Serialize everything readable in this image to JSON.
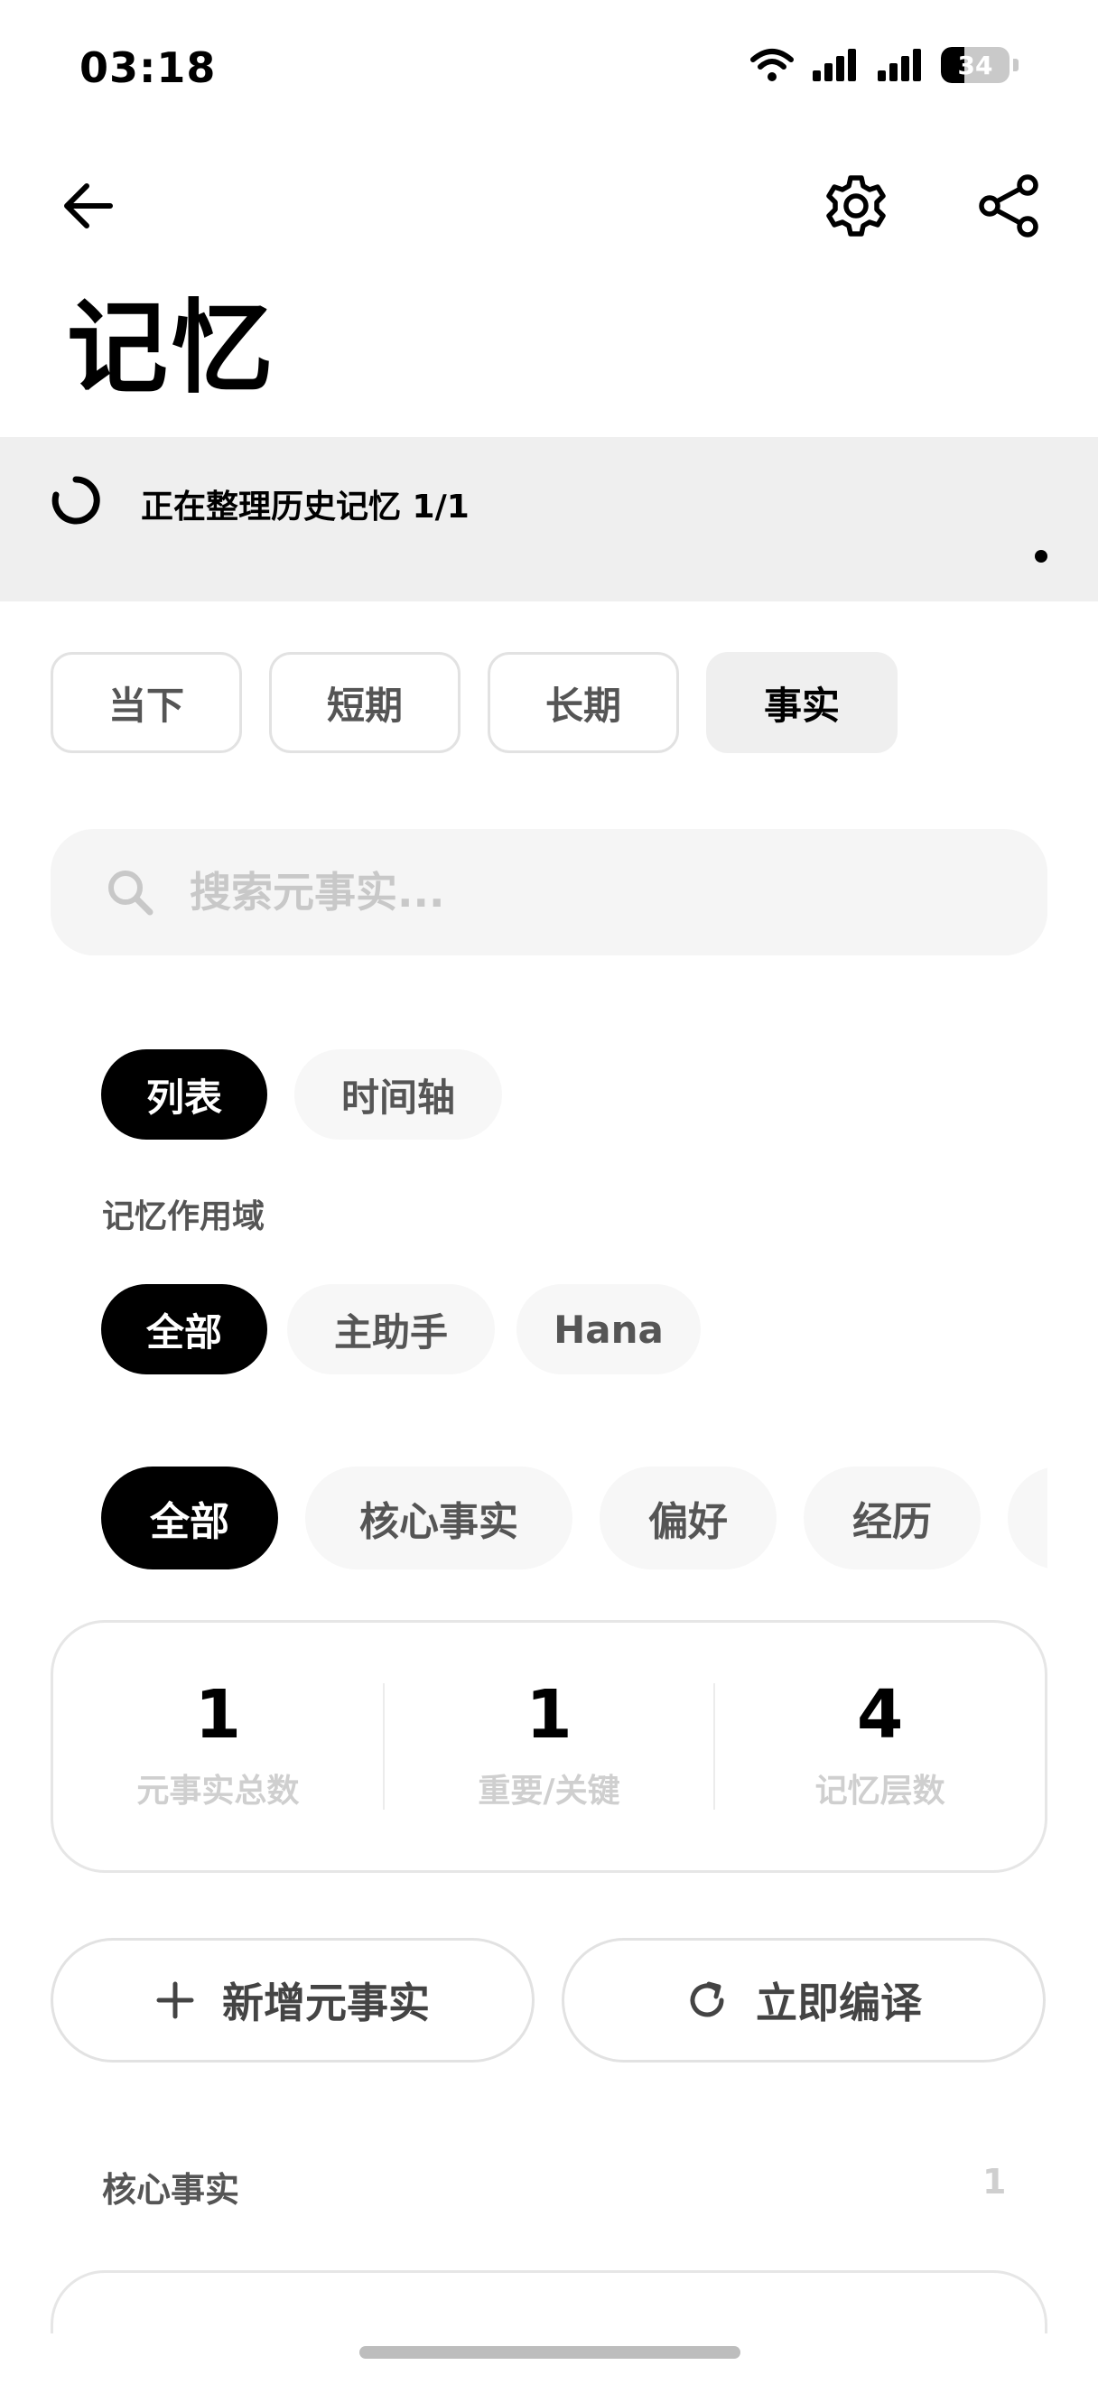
{
  "status_bar": {
    "time": "03:18",
    "battery_level": "34",
    "battery_fraction": 0.34,
    "icons": [
      "wifi-icon",
      "signal-icon",
      "signal-icon",
      "battery-icon"
    ]
  },
  "header": {
    "back_icon": "back-arrow-icon",
    "settings_icon": "gear-icon",
    "share_icon": "share-icon",
    "title": "记忆"
  },
  "banner": {
    "text": "正在整理历史记忆 1/1"
  },
  "tabs": [
    {
      "label": "当下",
      "active": false
    },
    {
      "label": "短期",
      "active": false
    },
    {
      "label": "长期",
      "active": false
    },
    {
      "label": "事实",
      "active": true
    }
  ],
  "search": {
    "placeholder": "搜索元事实...",
    "value": ""
  },
  "view_toggle": {
    "items": [
      "列表",
      "时间轴"
    ],
    "selected": "列表"
  },
  "scope": {
    "label": "记忆作用域",
    "items": [
      "全部",
      "主助手",
      "Hana"
    ],
    "selected": "全部"
  },
  "categories": {
    "items": [
      "全部",
      "核心事实",
      "偏好",
      "经历"
    ],
    "selected": "全部"
  },
  "stats": [
    {
      "value": "1",
      "label": "元事实总数"
    },
    {
      "value": "1",
      "label": "重要/关键"
    },
    {
      "value": "4",
      "label": "记忆层数"
    }
  ],
  "actions": {
    "add_label": "新增元事实",
    "add_icon": "plus-icon",
    "compile_label": "立即编译",
    "compile_icon": "refresh-icon"
  },
  "section": {
    "title": "核心事实",
    "count": "1"
  },
  "colors": {
    "accent_dark": "#000000",
    "banner_bg": "#efefef",
    "muted_text": "#cfcfcf"
  }
}
